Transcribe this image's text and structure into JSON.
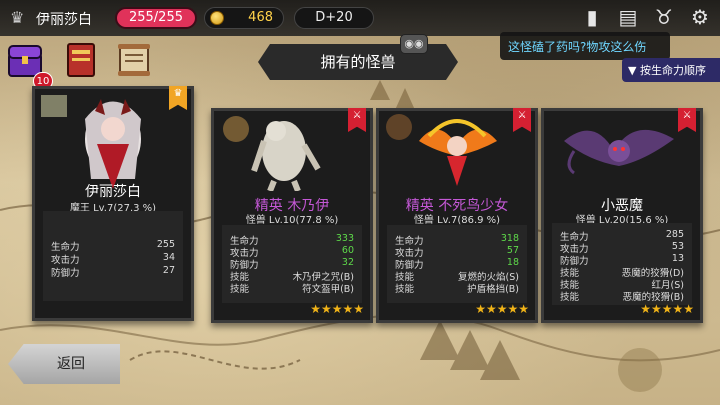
{
  "topbar": {
    "player_name": "伊丽莎白",
    "hp": "255/255",
    "gold": "468",
    "day": "D+20"
  },
  "items_badge": "10",
  "title": "拥有的怪兽",
  "tooltip": "这怪磕了药吗?物攻这么伤",
  "sort_label": "按生命力顺序",
  "cards": [
    {
      "name": "伊丽莎白",
      "elite": false,
      "level": "魔王 Lv.7(27.3 %)",
      "stats": [
        {
          "k": "生命力",
          "v": "255",
          "green": false
        },
        {
          "k": "攻击力",
          "v": "34",
          "green": false
        },
        {
          "k": "防御力",
          "v": "27",
          "green": false
        }
      ],
      "skills": [],
      "tag_color": "#f1a524",
      "stars": ""
    },
    {
      "name": "精英 木乃伊",
      "elite": true,
      "level": "怪兽 Lv.10(77.8 %)",
      "stats": [
        {
          "k": "生命力",
          "v": "333",
          "green": true
        },
        {
          "k": "攻击力",
          "v": "60",
          "green": true
        },
        {
          "k": "防御力",
          "v": "32",
          "green": true
        }
      ],
      "skills": [
        {
          "k": "技能",
          "v": "木乃伊之咒(B)"
        },
        {
          "k": "技能",
          "v": "符文盔甲(B)"
        }
      ],
      "tag_color": "#d52032",
      "stars": "★★★★★"
    },
    {
      "name": "精英 不死鸟少女",
      "elite": true,
      "level": "怪兽 Lv.7(86.9 %)",
      "stats": [
        {
          "k": "生命力",
          "v": "318",
          "green": true
        },
        {
          "k": "攻击力",
          "v": "57",
          "green": true
        },
        {
          "k": "防御力",
          "v": "18",
          "green": true
        }
      ],
      "skills": [
        {
          "k": "技能",
          "v": "复燃的火焰(S)"
        },
        {
          "k": "技能",
          "v": "护盾格挡(B)"
        }
      ],
      "tag_color": "#d52032",
      "stars": "★★★★★"
    },
    {
      "name": "小恶魔",
      "elite": false,
      "level": "怪兽 Lv.20(15.6 %)",
      "stats": [
        {
          "k": "生命力",
          "v": "285",
          "green": false
        },
        {
          "k": "攻击力",
          "v": "53",
          "green": false
        },
        {
          "k": "防御力",
          "v": "13",
          "green": false
        }
      ],
      "skills": [
        {
          "k": "技能",
          "v": "恶魔的狡猾(D)"
        },
        {
          "k": "技能",
          "v": "红月(S)"
        },
        {
          "k": "技能",
          "v": "恶魔的狡猾(B)"
        }
      ],
      "tag_color": "#d52032",
      "stars": "★★★★★"
    }
  ],
  "back_label": "返回"
}
